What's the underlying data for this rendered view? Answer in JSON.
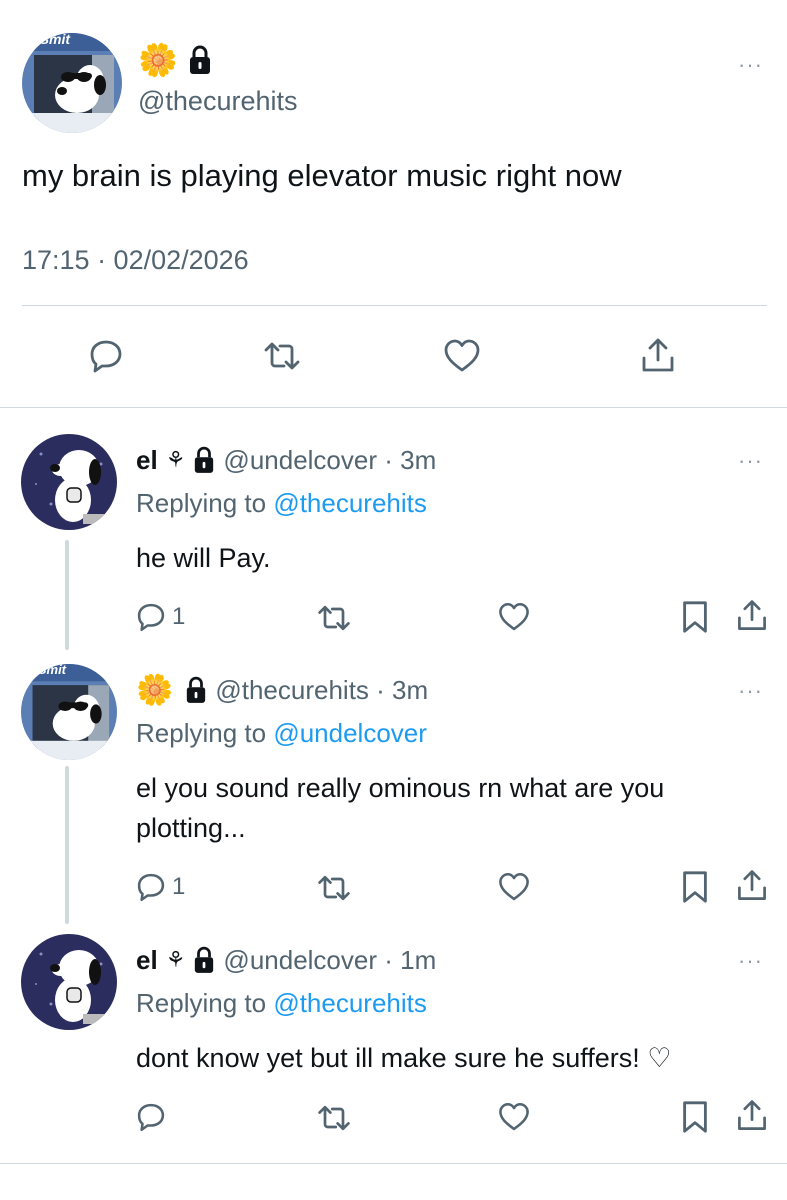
{
  "main_tweet": {
    "handle": "@thecurehits",
    "text": "my brain is playing elevator music right now",
    "timestamp": "17:15 · 02/02/2026",
    "avatar_text": "e Smit",
    "more": "···"
  },
  "replies": [
    {
      "name": "el",
      "handle_time": "@undelcover · 3m",
      "replying_prefix": "Replying to ",
      "replying_to": "@thecurehits",
      "text": "he will Pay.",
      "reply_count": "1",
      "more": "···"
    },
    {
      "handle_time": "@thecurehits · 3m",
      "replying_prefix": "Replying to ",
      "replying_to": "@undelcover",
      "text_line1": "el you sound really ominous rn what are you",
      "text_line2": "plotting...",
      "reply_count": "1",
      "avatar_text": "e Smit",
      "more": "···"
    },
    {
      "name": "el",
      "handle_time": "@undelcover · 1m",
      "replying_prefix": "Replying to ",
      "replying_to": "@thecurehits",
      "text": "dont know yet but ill make sure he suffers! ♡",
      "more": "···"
    }
  ],
  "icons": {
    "flower": "🌼",
    "lock": "lock-icon",
    "plant": "⚘"
  },
  "colors": {
    "link": "#1d9bf0",
    "muted": "#536471",
    "divider": "#cfd9de",
    "avatar_dark": "#2b2d5e"
  }
}
